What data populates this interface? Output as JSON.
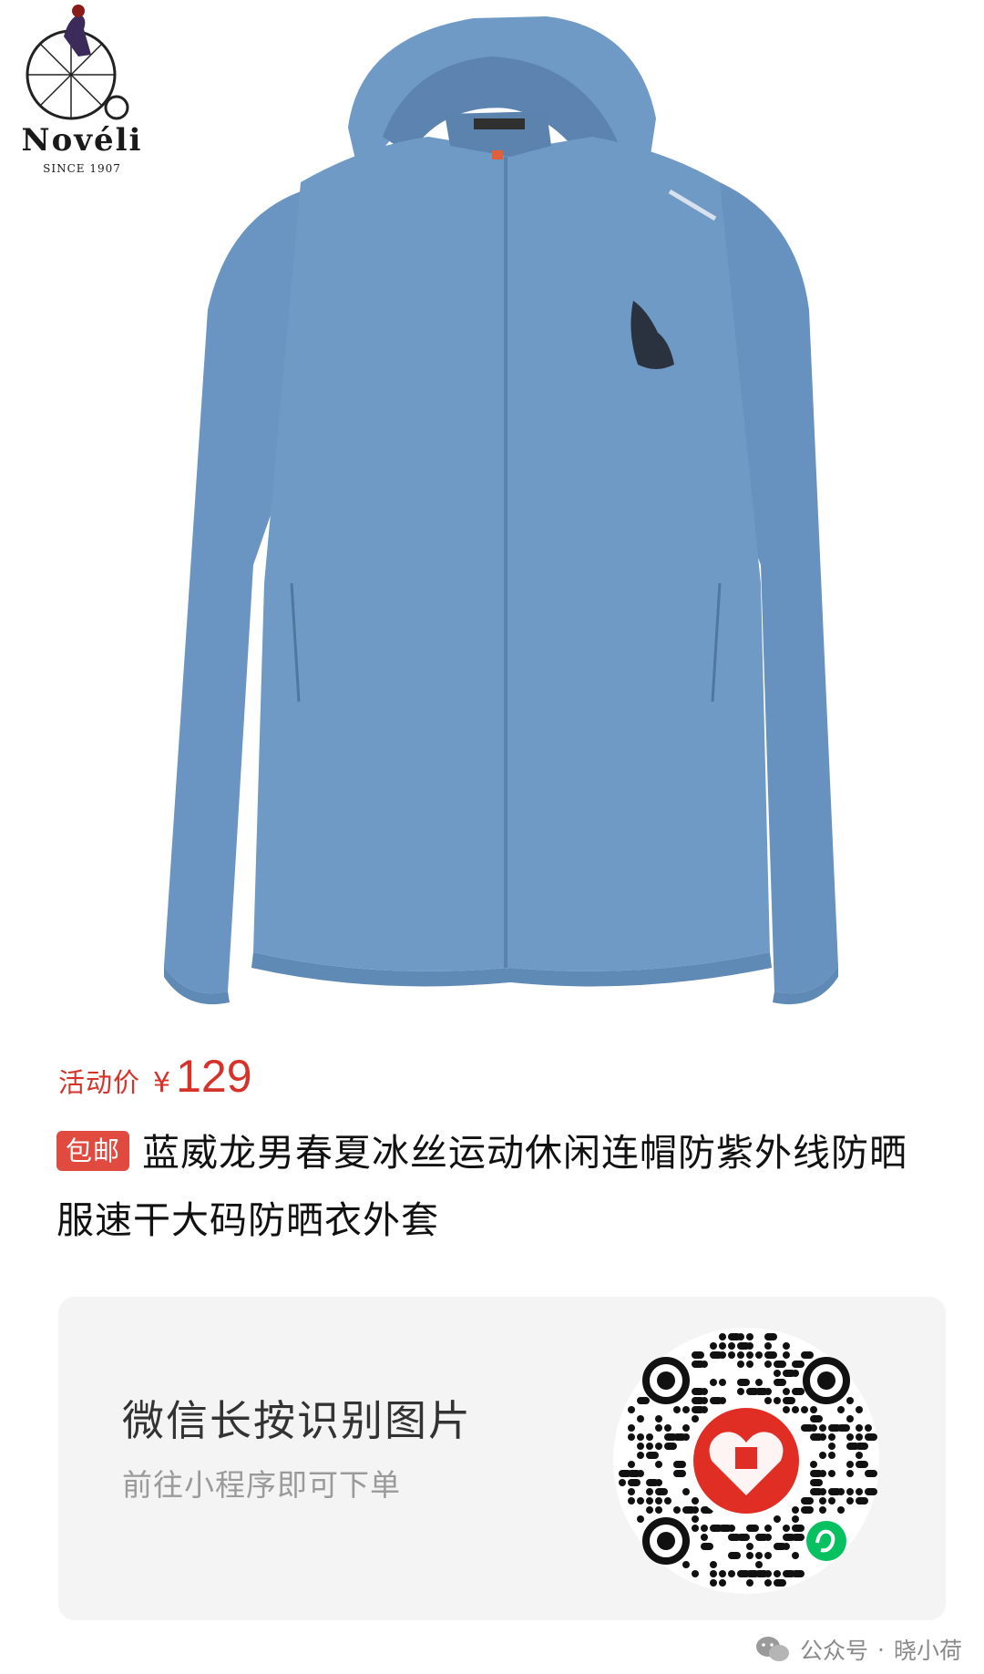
{
  "brand": {
    "name": "Novéli",
    "since": "SINCE 1907"
  },
  "product": {
    "image_icon": "blue-hooded-jacket",
    "color": "#6f9ac6"
  },
  "price": {
    "label": "活动价",
    "currency": "¥",
    "value": "129",
    "color": "#d6322a"
  },
  "title": {
    "badge": "包邮",
    "text": "蓝威龙男春夏冰丝运动休闲连帽防紫外线防晒服速干大码防晒衣外套"
  },
  "mini_program": {
    "title": "微信长按识别图片",
    "subtitle": "前往小程序即可下单",
    "qr_icon": "pinduoduo-qr-code-icon"
  },
  "watermark": {
    "icon": "wechat-official-account-icon",
    "label": "公众号",
    "separator": "·",
    "account": "晓小荷"
  }
}
